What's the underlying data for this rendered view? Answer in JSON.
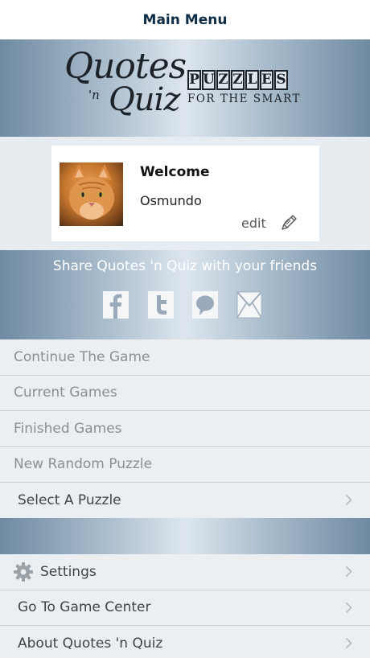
{
  "navbar": {
    "title": "Main Menu"
  },
  "logo": {
    "script_line1": "Quotes",
    "script_amp": "'n",
    "script_line2": "Quiz",
    "puzzle_letters": [
      "P",
      "U",
      "Z",
      "Z",
      "L",
      "E",
      "S"
    ],
    "tagline": "FOR THE SMART"
  },
  "profile": {
    "welcome": "Welcome",
    "username": "Osmundo",
    "edit_label": "edit"
  },
  "share": {
    "title": "Share Quotes 'n Quiz with your friends",
    "icons": [
      "facebook-icon",
      "twitter-icon",
      "chat-bubble-icon",
      "mail-icon"
    ]
  },
  "menu_primary": [
    {
      "label": "Continue The Game"
    },
    {
      "label": "Current Games"
    },
    {
      "label": "Finished Games"
    },
    {
      "label": "New Random Puzzle"
    },
    {
      "label": "Select A Puzzle"
    }
  ],
  "menu_secondary": [
    {
      "label": "Settings"
    },
    {
      "label": "Go To Game Center"
    },
    {
      "label": "About Quotes 'n Quiz"
    }
  ],
  "colors": {
    "nav_title": "#0e2e47",
    "banner_edge": "#6f8aa2",
    "banner_center": "#dde6ee",
    "menu_bg": "#eceff1",
    "menu_text_muted": "#8a8f93",
    "menu_text_dark": "#3f4449"
  }
}
